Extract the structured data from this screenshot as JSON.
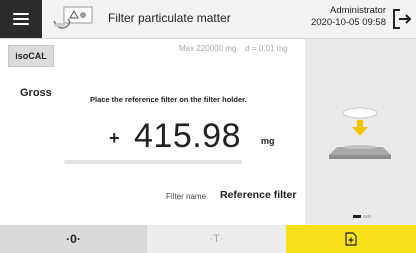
{
  "header": {
    "title": "Filter particulate matter",
    "user": "Administrator",
    "datetime": "2020-10-05  09:58",
    "menu_icon": "hamburger-icon",
    "app_icon": "balance-filter-icon",
    "logout_icon": "logout-icon"
  },
  "side_tab": {
    "label": "isoCAL"
  },
  "capacity": {
    "max": "Max 220000 mg",
    "readability": "d = 0.01 mg"
  },
  "weighing": {
    "mode": "Gross",
    "instruction": "Place the reference filter on the filter holder.",
    "sign": "+",
    "value": "415.98",
    "unit": "mg"
  },
  "filter": {
    "label": "Filter name",
    "value": "Reference filter"
  },
  "illustration": {
    "icon": "place-filter-on-holder-icon",
    "pager_active": 1,
    "pager_total": 2
  },
  "bottom_bar": {
    "zero_label": "·0·",
    "tare_label": "·T·",
    "action_icon": "add-document-icon"
  },
  "colors": {
    "accent": "#f7e11b",
    "menu_bg": "#2b2b2b",
    "illustration_arrow": "#f5c400"
  }
}
